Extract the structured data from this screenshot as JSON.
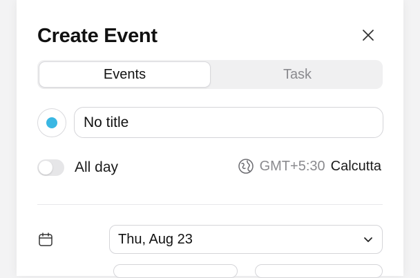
{
  "dialog": {
    "title": "Create Event",
    "close_icon": "close-icon"
  },
  "tabs": [
    {
      "label": "Events",
      "active": true
    },
    {
      "label": "Task",
      "active": false
    }
  ],
  "event": {
    "color": "#3ab7e3",
    "title_value": "No title"
  },
  "all_day": {
    "label": "All day",
    "enabled": false
  },
  "timezone": {
    "icon": "globe-icon",
    "offset": "GMT+5:30",
    "city": "Calcutta"
  },
  "date": {
    "icon": "calendar-icon",
    "value": "Thu, Aug 23",
    "chevron": "chevron-down-icon"
  }
}
